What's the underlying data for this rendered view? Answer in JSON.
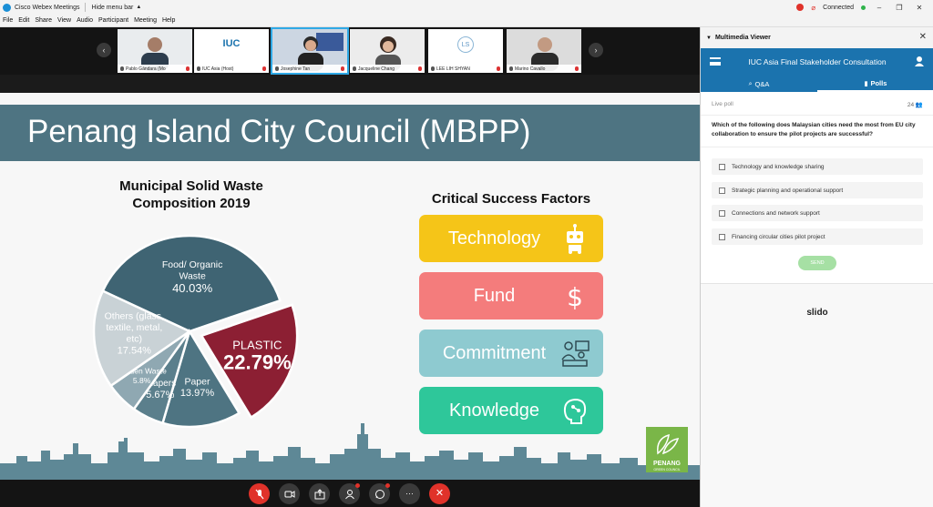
{
  "window": {
    "app_title": "Cisco Webex Meetings",
    "hide_menu": "Hide menu bar",
    "status": "Connected"
  },
  "menu": [
    "File",
    "Edit",
    "Share",
    "View",
    "Audio",
    "Participant",
    "Meeting",
    "Help"
  ],
  "participants": [
    {
      "name": "Pablo Gándara (Mo"
    },
    {
      "name": "IUC Asia (Host)",
      "logo": "IUC"
    },
    {
      "name": "Josephine Tan"
    },
    {
      "name": "Jacqueline Chang"
    },
    {
      "name": "LEE LIH SHYAN",
      "initials": "LS"
    },
    {
      "name": "Marino Cavallo"
    }
  ],
  "slide": {
    "title": "Penang Island City Council (MBPP)",
    "pie_title_line1": "Municipal Solid Waste",
    "pie_title_line2": "Composition 2019",
    "csf_title": "Critical Success Factors",
    "csf": [
      {
        "label": "Technology",
        "color": "#f5c518",
        "icon": "robot-icon"
      },
      {
        "label": "Fund",
        "color": "#f47c7c",
        "icon": "dollar-icon"
      },
      {
        "label": "Commitment",
        "color": "#8ecad0",
        "icon": "people-meeting-icon"
      },
      {
        "label": "Knowledge",
        "color": "#2ec79a",
        "icon": "brain-icon"
      }
    ],
    "logo_text": "PENANG",
    "logo_sub": "GREEN COUNCIL"
  },
  "chart_data": {
    "type": "pie",
    "title": "Municipal Solid Waste Composition 2019",
    "slices": [
      {
        "label": "Food/ Organic  Waste",
        "value": 40.03,
        "display": "40.03%",
        "color": "#3f6473"
      },
      {
        "label": "PLASTIC",
        "value": 22.79,
        "display": "22.79%",
        "color": "#8c1f33"
      },
      {
        "label": "Paper",
        "value": 13.97,
        "display": "13.97%",
        "color": "#4e7482"
      },
      {
        "label": "Diapers",
        "value": 5.67,
        "display": "5.67%",
        "color": "#5b7f8c"
      },
      {
        "label": "Garden Waste",
        "value": 5.8,
        "display": "5.8%",
        "color": "#8fa8b2"
      },
      {
        "label": "Others (glass, textile, metal, etc)",
        "value": 17.54,
        "display": "17.54%",
        "color": "#c9d2d6"
      }
    ]
  },
  "panel": {
    "title": "Multimedia Viewer",
    "event_title": "IUC Asia Final Stakeholder Consultation",
    "tab_qa": "Q&A",
    "tab_polls": "Polls",
    "live_poll": "Live poll",
    "votes": "24",
    "question": "Which of the following does Malaysian cities need the most from EU city collaboration to ensure the pilot projects are successful?",
    "options": [
      "Technology and knowledge sharing",
      "Strategic planning and operational support",
      "Connections and network support",
      "Financing circular cities pilot project"
    ],
    "send": "SEND",
    "brand": "slido"
  },
  "colors": {
    "accent": "#1b73ae",
    "slide_header": "#4e7482",
    "end_call": "#e0322a"
  }
}
